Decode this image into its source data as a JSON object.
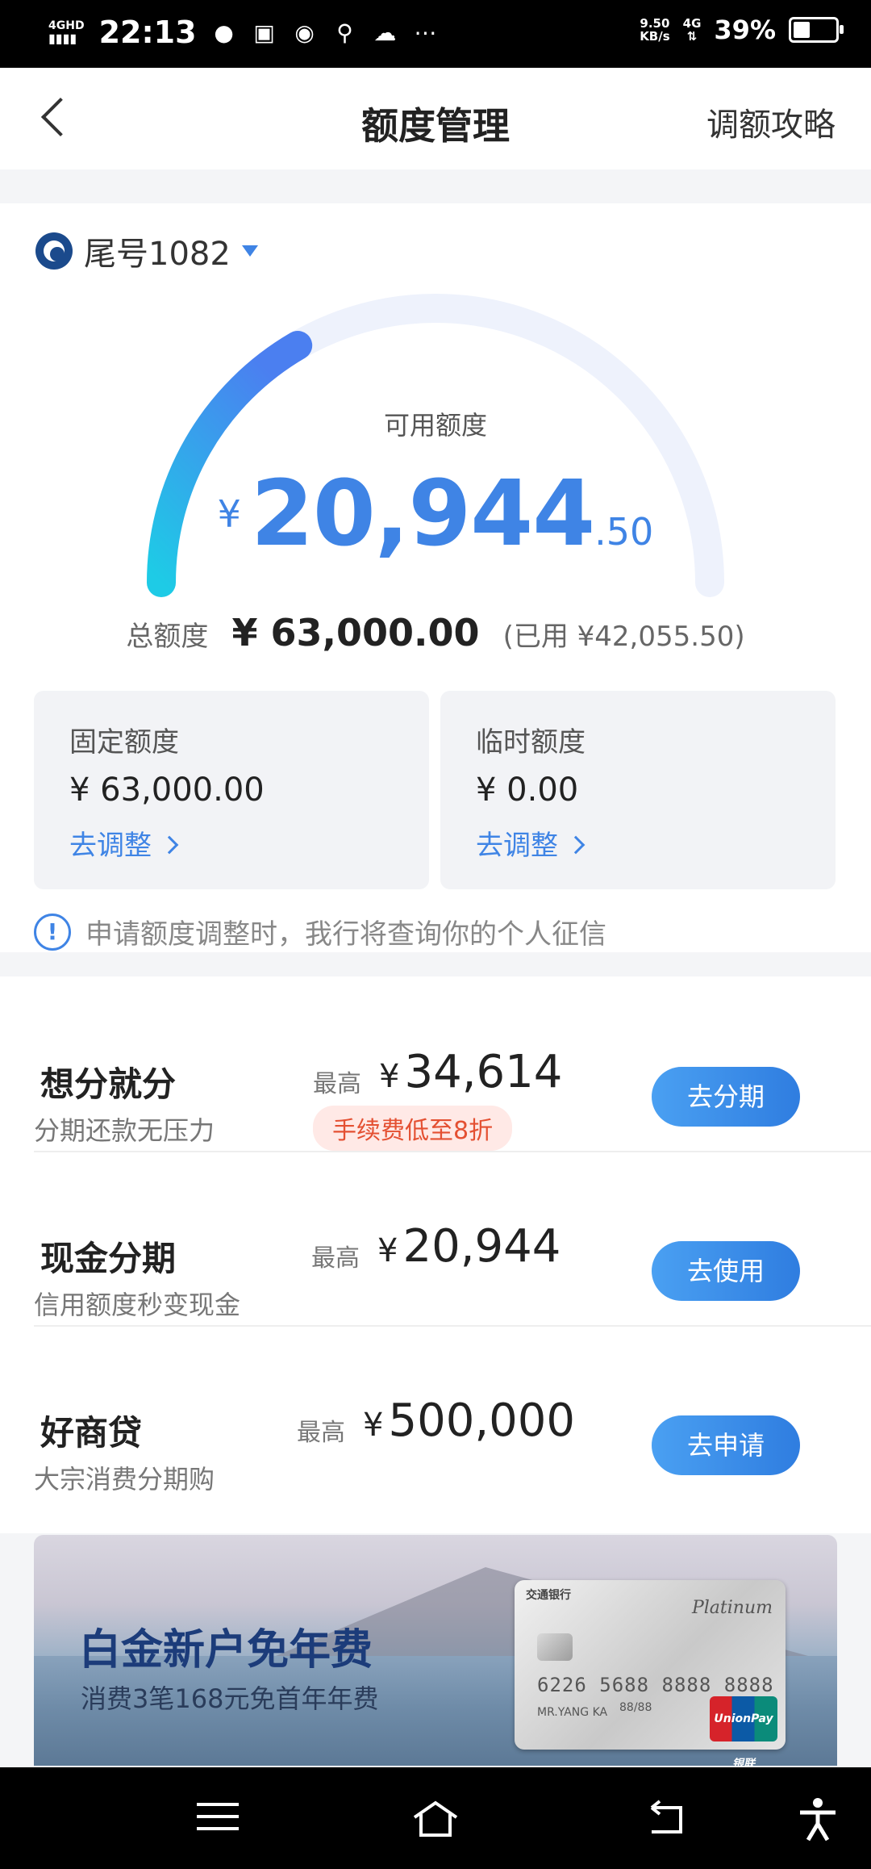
{
  "status_bar": {
    "network": "4GHD",
    "time": "22:13",
    "speed": "9.50",
    "speed_unit": "KB/s",
    "net_type": "4G",
    "battery": "39%",
    "battery_level": 0.39
  },
  "header": {
    "title": "额度管理",
    "right_link": "调额攻略"
  },
  "card": {
    "label": "尾号1082"
  },
  "gauge": {
    "available_label": "可用额度",
    "currency": "¥",
    "available_int": "20,944",
    "available_dec": ".50",
    "available_fraction": 0.3325,
    "track_color": "#eef2fc",
    "fill_start_color": "#1ecbe6",
    "fill_end_color": "#4b7ff0"
  },
  "total": {
    "label": "总额度",
    "amount": "¥ 63,000.00",
    "used": "(已用 ¥42,055.50)"
  },
  "quotas": {
    "fixed": {
      "title": "固定额度",
      "amount": "¥ 63,000.00",
      "link": "去调整"
    },
    "temp": {
      "title": "临时额度",
      "amount": "¥ 0.00",
      "link": "去调整"
    }
  },
  "notice": {
    "icon": "info-icon",
    "text": "申请额度调整时，我行将查询你的个人征信"
  },
  "products": [
    {
      "name": "想分就分",
      "sub": "分期还款无压力",
      "max_label": "最高",
      "currency": "¥",
      "amount": "34,614",
      "tag": "手续费低至8折",
      "button": "去分期"
    },
    {
      "name": "现金分期",
      "sub": "信用额度秒变现金",
      "max_label": "最高",
      "currency": "¥",
      "amount": "20,944",
      "button": "去使用"
    },
    {
      "name": "好商贷",
      "sub": "大宗消费分期购",
      "max_label": "最高",
      "currency": "¥",
      "amount": "500,000",
      "button": "去申请"
    }
  ],
  "banner": {
    "title": "白金新户免年费",
    "subtitle": "消费3笔168元免首年年费",
    "card_bank": "交通银行",
    "card_tier": "Platinum",
    "card_number": "6226 5688 8888 8888",
    "card_holder": "MR.YANG KA",
    "card_valid": "88/88",
    "card_brand": "UnionPay银联"
  },
  "colors": {
    "accent": "#3f84e5",
    "tag_bg": "#ffe9e6",
    "tag_text": "#e45032"
  }
}
